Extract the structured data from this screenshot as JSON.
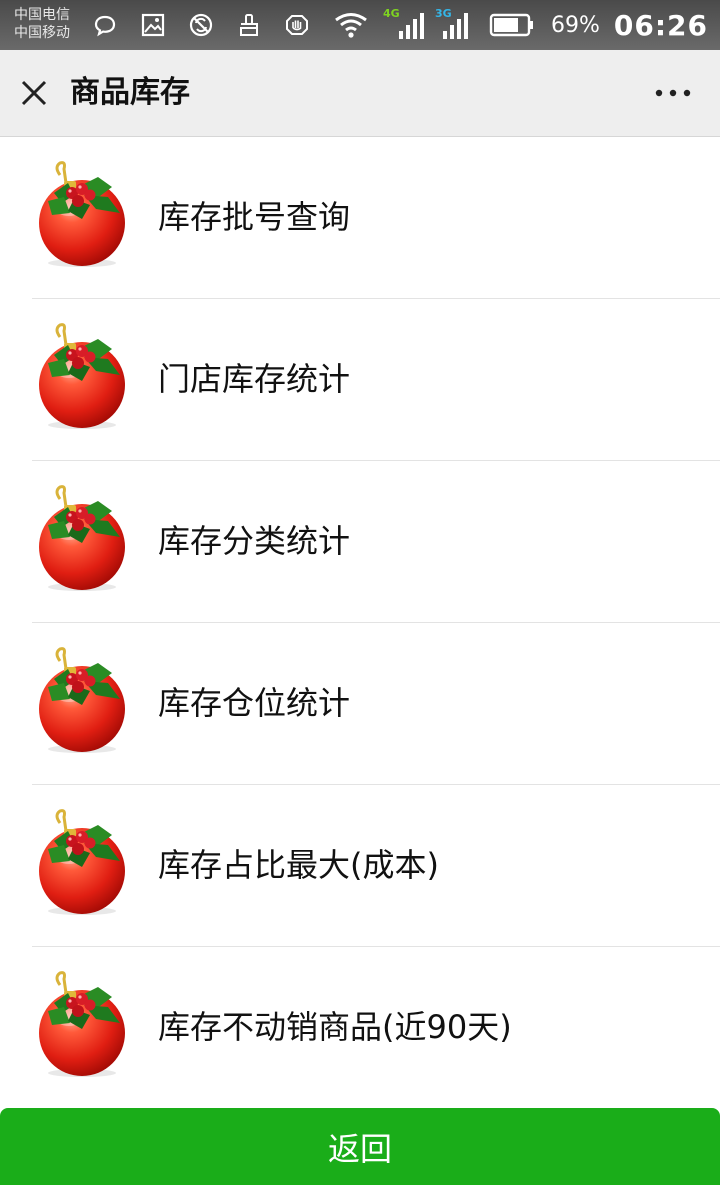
{
  "status_bar": {
    "carrier_1": "中国电信",
    "carrier_2": "中国移动",
    "icons_left": [
      "chat-bubble-icon",
      "image-icon",
      "blocked-sync-icon",
      "clean-brush-icon",
      "hand-stop-icon"
    ],
    "icons_right": [
      "wifi-icon",
      "signal-4g-icon",
      "signal-3g-icon",
      "battery-icon"
    ],
    "network_label_1": "4G",
    "network_label_2": "3G",
    "battery": "69%",
    "time": "06:26"
  },
  "header": {
    "title": "商品库存",
    "close_icon": "close-icon",
    "more_icon": "more-dots-icon"
  },
  "menu": {
    "icon": "christmas-ornament-icon",
    "items": [
      {
        "label": "库存批号查询"
      },
      {
        "label": "门店库存统计"
      },
      {
        "label": "库存分类统计"
      },
      {
        "label": "库存仓位统计"
      },
      {
        "label": "库存占比最大(成本)"
      },
      {
        "label": "库存不动销商品(近90天)"
      }
    ]
  },
  "footer": {
    "back_label": "返回"
  },
  "colors": {
    "status_bar": "#5a5a5a",
    "title_bar": "#eeeeee",
    "accent_green": "#1aad19",
    "ornament_red": "#e8281c"
  }
}
